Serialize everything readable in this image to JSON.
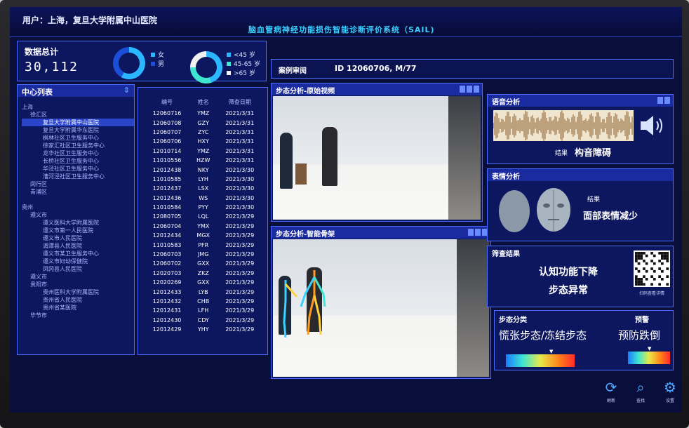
{
  "header": {
    "user": "用户：上海，复旦大学附属中山医院",
    "system_title": "脑血管病神经功能损伤智能诊断评价系统（SAIL)"
  },
  "stats": {
    "label": "数据总计",
    "value": "30,112",
    "gender_legend": [
      "女",
      "男"
    ],
    "age_legend": [
      "<45 岁",
      "45-65 岁",
      ">65 岁"
    ]
  },
  "center_list": {
    "title": "中心列表",
    "items": [
      "上海",
      "徐汇区",
      "复旦大学附属中山医院",
      "复旦大学附属华东医院",
      "枫林社区卫生服务中心",
      "徐家汇社区卫生服务中心",
      "龙华社区卫生服务中心",
      "长桥社区卫生服务中心",
      "华泾社区卫生服务中心",
      "漕河泾社区卫生服务中心",
      "闵行区",
      "青浦区",
      "",
      "贵州",
      "遵义市",
      "遵义医科大学附属医院",
      "遵义市第一人民医院",
      "遵义市人民医院",
      "湄潭县人民医院",
      "遵义市某卫生服务中心",
      "遵义市妇幼保健院",
      "凤冈县人民医院",
      "遵义市",
      "贵阳市",
      "贵州医科大学附属医院",
      "贵州省人民医院",
      "贵州省某医院",
      "毕节市"
    ]
  },
  "records_table": {
    "headers": [
      "编号",
      "姓名",
      "筛查日期"
    ],
    "rows": [
      [
        "12060716",
        "YMZ",
        "2021/3/31"
      ],
      [
        "12060708",
        "GZY",
        "2021/3/31"
      ],
      [
        "12060707",
        "ZYC",
        "2021/3/31"
      ],
      [
        "12060706",
        "HXY",
        "2021/3/31"
      ],
      [
        "12010714",
        "YMZ",
        "2021/3/31"
      ],
      [
        "11010556",
        "HZW",
        "2021/3/31"
      ],
      [
        "12012438",
        "NKY",
        "2021/3/30"
      ],
      [
        "11010585",
        "LYH",
        "2021/3/30"
      ],
      [
        "12012437",
        "LSX",
        "2021/3/30"
      ],
      [
        "12012436",
        "WS",
        "2021/3/30"
      ],
      [
        "11010584",
        "PYY",
        "2021/3/30"
      ],
      [
        "12080705",
        "LQL",
        "2021/3/29"
      ],
      [
        "12060704",
        "YMX",
        "2021/3/29"
      ],
      [
        "12012434",
        "MGX",
        "2021/3/29"
      ],
      [
        "11010583",
        "PFR",
        "2021/3/29"
      ],
      [
        "12060703",
        "JMG",
        "2021/3/29"
      ],
      [
        "12060702",
        "GXX",
        "2021/3/29"
      ],
      [
        "12020703",
        "ZKZ",
        "2021/3/29"
      ],
      [
        "12020269",
        "GXX",
        "2021/3/29"
      ],
      [
        "12012433",
        "LYB",
        "2021/3/29"
      ],
      [
        "12012432",
        "CHB",
        "2021/3/29"
      ],
      [
        "12012431",
        "LFH",
        "2021/3/29"
      ],
      [
        "12012430",
        "CDY",
        "2021/3/29"
      ],
      [
        "12012429",
        "YHY",
        "2021/3/29"
      ]
    ]
  },
  "case_review": {
    "label": "案例审阅",
    "case_id": "ID 12060706,  M/77"
  },
  "gait_raw": {
    "title": "步态分析-原始视频"
  },
  "gait_skeleton": {
    "title": "步态分析-智能骨架"
  },
  "voice": {
    "title": "语音分析",
    "result_label": "结果",
    "result": "构音障碍"
  },
  "face": {
    "title": "表情分析",
    "result_label": "结果",
    "result": "面部表情减少"
  },
  "screening": {
    "title": "筛查结果",
    "line1": "认知功能下降",
    "line2": "步态异常",
    "qr_caption": "扫码查看详情"
  },
  "gait_class": {
    "label": "步态分类",
    "warning_label": "预警",
    "classification": "慌张步态/冻结步态",
    "warning": "预防跌倒"
  },
  "toolbar": {
    "refresh": "刷新",
    "search": "查找",
    "settings": "设置"
  },
  "colors": {
    "accent": "#3ad0ff",
    "panel": "#0d1760",
    "border": "#4a6cff"
  }
}
